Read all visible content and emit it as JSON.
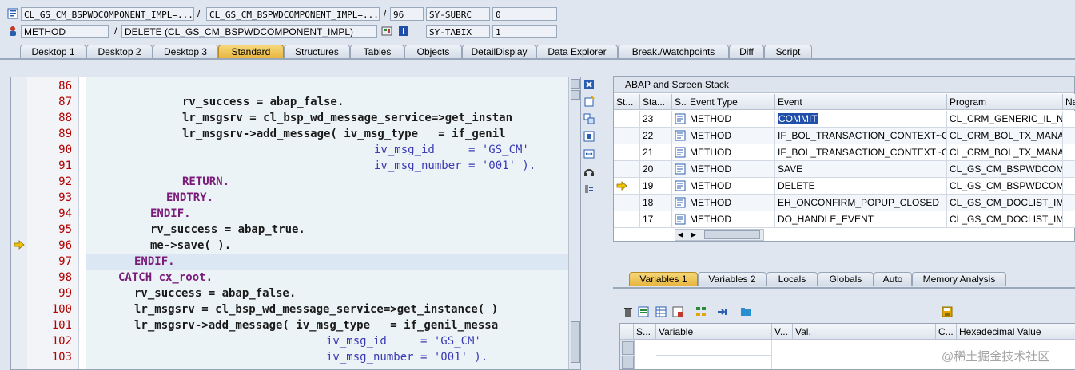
{
  "header": {
    "row1": {
      "class_field": "CL_GS_CM_BSPWDCOMPONENT_IMPL=...",
      "class_field2": "CL_GS_CM_BSPWDCOMPONENT_IMPL=...",
      "line": "96",
      "sys_var": "SY-SUBRC",
      "sys_val": "0"
    },
    "row2": {
      "type_field": "METHOD",
      "method_field": "DELETE (CL_GS_CM_BSPWDCOMPONENT_IMPL)",
      "sys_var": "SY-TABIX",
      "sys_val": "1"
    },
    "slash": "/"
  },
  "tabs": [
    "Desktop 1",
    "Desktop 2",
    "Desktop 3",
    "Standard",
    "Structures",
    "Tables",
    "Objects",
    "DetailDisplay",
    "Data Explorer",
    "Break./Watchpoints",
    "Diff",
    "Script"
  ],
  "active_tab": "Standard",
  "editor": {
    "current_line": "96",
    "lines": [
      {
        "n": "86",
        "text": ""
      },
      {
        "n": "87",
        "text": "rv_success = abap_false."
      },
      {
        "n": "88",
        "text": "lr_msgsrv = cl_bsp_wd_message_service=>get_instan"
      },
      {
        "n": "89",
        "text": "lr_msgsrv->add_message( iv_msg_type   = if_genil"
      },
      {
        "n": "90",
        "text": "iv_msg_id     = 'GS_CM'"
      },
      {
        "n": "91",
        "text": "iv_msg_number = '001' )."
      },
      {
        "n": "92",
        "text": "RETURN."
      },
      {
        "n": "93",
        "text": "ENDTRY."
      },
      {
        "n": "94",
        "text": "ENDIF."
      },
      {
        "n": "95",
        "text": "rv_success = abap_true."
      },
      {
        "n": "96",
        "text": "me->save( )."
      },
      {
        "n": "97",
        "text": "ENDIF."
      },
      {
        "n": "98",
        "text": "CATCH cx_root."
      },
      {
        "n": "99",
        "text": "rv_success = abap_false."
      },
      {
        "n": "100",
        "text": "lr_msgsrv = cl_bsp_wd_message_service=>get_instance( )"
      },
      {
        "n": "101",
        "text": "lr_msgsrv->add_message( iv_msg_type   = if_genil_messa"
      },
      {
        "n": "102",
        "text": "iv_msg_id     = 'GS_CM'"
      },
      {
        "n": "103",
        "text": "iv_msg_number = '001' )."
      }
    ]
  },
  "stack": {
    "title": "ABAP and Screen Stack",
    "headers": [
      "St...",
      "Sta...",
      "S...",
      "Event Type",
      "Event",
      "Program",
      "Na"
    ],
    "rows": [
      {
        "level": "23",
        "type": "METHOD",
        "event": "COMMIT",
        "program": "CL_CRM_GENERIC_IL_NE..."
      },
      {
        "level": "22",
        "type": "METHOD",
        "event": "IF_BOL_TRANSACTION_CONTEXT~C...",
        "program": "CL_CRM_BOL_TX_MANA..."
      },
      {
        "level": "21",
        "type": "METHOD",
        "event": "IF_BOL_TRANSACTION_CONTEXT~C...",
        "program": "CL_CRM_BOL_TX_MANA..."
      },
      {
        "level": "20",
        "type": "METHOD",
        "event": "SAVE",
        "program": "CL_GS_CM_BSPWDCOMP..."
      },
      {
        "level": "19",
        "type": "METHOD",
        "event": "DELETE",
        "program": "CL_GS_CM_BSPWDCOMP..."
      },
      {
        "level": "18",
        "type": "METHOD",
        "event": "EH_ONCONFIRM_POPUP_CLOSED",
        "program": "CL_GS_CM_DOCLIST_IM..."
      },
      {
        "level": "17",
        "type": "METHOD",
        "event": "DO_HANDLE_EVENT",
        "program": "CL_GS_CM_DOCLIST_IM..."
      }
    ]
  },
  "variables": {
    "tabs": [
      "Variables 1",
      "Variables 2",
      "Locals",
      "Globals",
      "Auto",
      "Memory Analysis"
    ],
    "active_tab": "Variables 1",
    "headers": [
      "S...",
      "Variable",
      "V...",
      "Val.",
      "C...",
      "Hexadecimal Value"
    ]
  },
  "watermark": "@稀土掘金技术社区",
  "colors": {
    "active_tab": "#e7b43d",
    "line_numbers": "#b30000",
    "keyword": "#7a1b7a",
    "string": "#3a3ab5"
  }
}
